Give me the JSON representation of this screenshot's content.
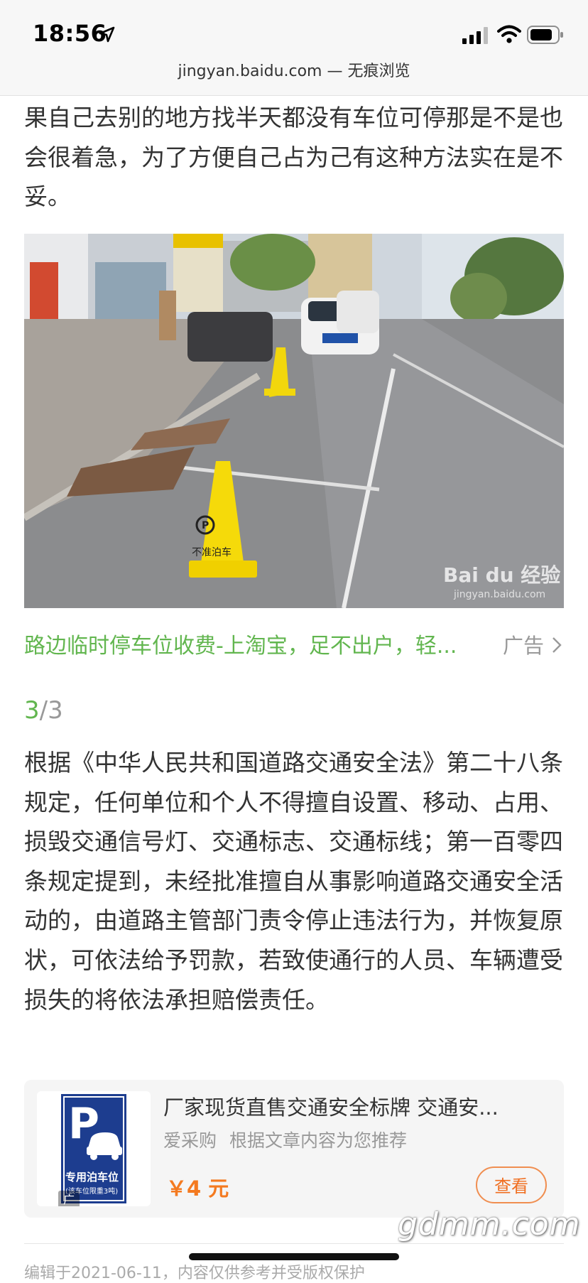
{
  "status_bar": {
    "time": "18:56",
    "icons": [
      "location-arrow-icon",
      "cellular-signal-icon",
      "wifi-icon",
      "battery-icon"
    ]
  },
  "browser": {
    "domain": "jingyan.baidu.com",
    "separator": " — ",
    "mode": "无痕浏览"
  },
  "article": {
    "paragraph_1": "果自己去别的地方找半天都没有车位可停那是不是也会很着急，为了方便自己占为己有这种方法实在是不妥。",
    "image_watermark": "Bai du 经验",
    "image_watermark_url": "jingyan.baidu.com",
    "cone_text": "不准泊车",
    "ad_link": {
      "text": "路边临时停车位收费-上淘宝，足不出户，轻...",
      "tag": "广告"
    },
    "step": {
      "current": "3",
      "total": "/3"
    },
    "paragraph_2": "根据《中华人民共和国道路交通安全法》第二十八条规定，任何单位和个人不得擅自设置、移动、占用、损毁交通信号灯、交通标志、交通标线；第一百零四条规定提到，未经批准擅自从事影响道路交通安全活动的，由道路主管部门责令停止违法行为，并恢复原状，可依法给予罚款，若致使通行的人员、车辆遭受损失的将依法承担赔偿责任。"
  },
  "product_card": {
    "title": "厂家现货直售交通安全标牌 交通安...",
    "seller": "爱采购",
    "note": "根据文章内容为您推荐",
    "price": "￥4 元",
    "button": "查看",
    "ad_badge": "广告",
    "sign_letter": "P",
    "sign_text": "专用泊车位",
    "sign_subtext": "(该车位限重3吨)"
  },
  "watermark": "gdmm.com",
  "footer": "编辑于2021-06-11，内容仅供参考并受版权保护",
  "colors": {
    "accent_green": "#62b64f",
    "price_orange": "#f47a20",
    "sign_blue": "#1d3d8f"
  }
}
